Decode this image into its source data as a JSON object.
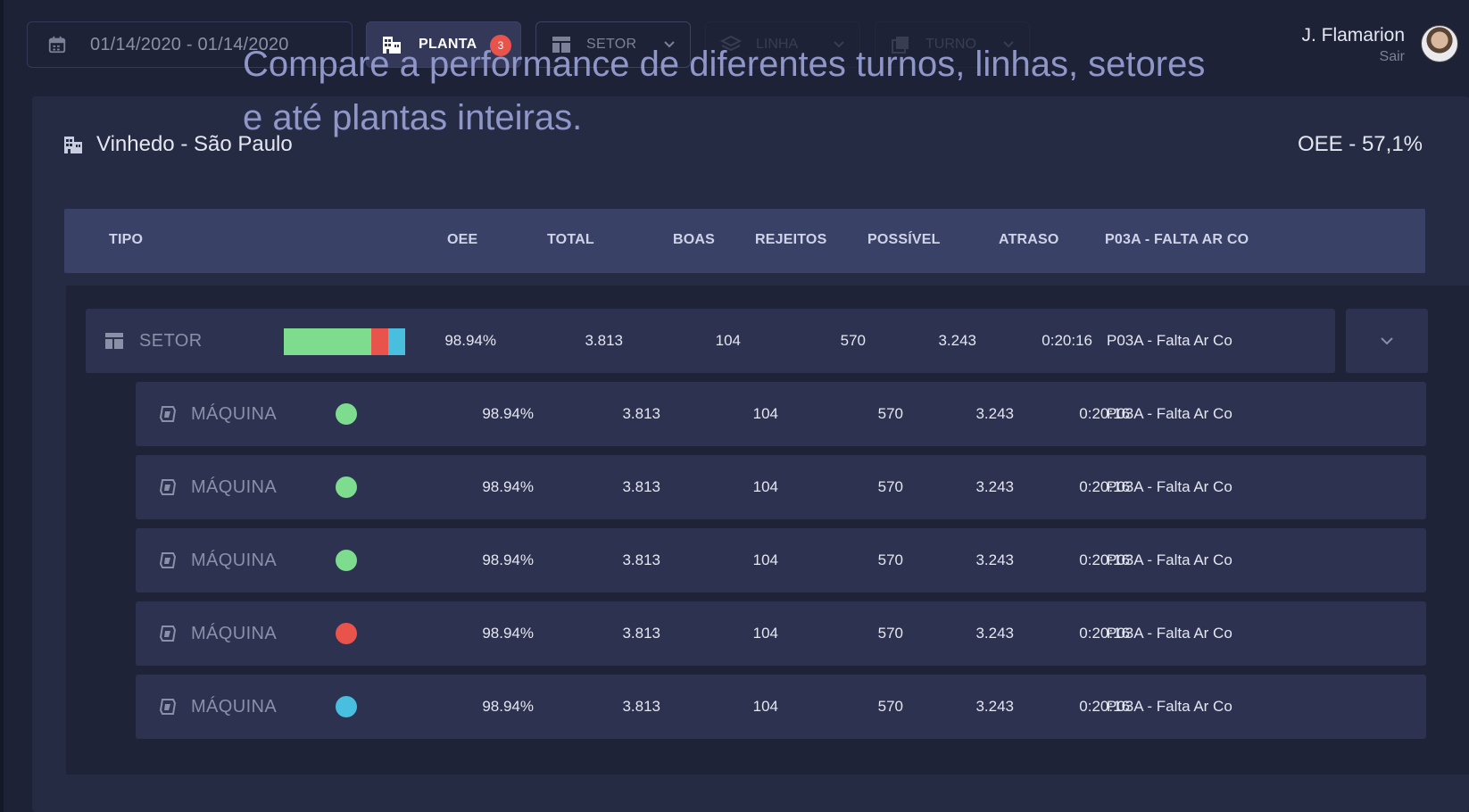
{
  "topbar": {
    "date_range": "01/14/2020 - 01/14/2020",
    "planta_label": "PLANTA",
    "planta_badge": "3",
    "setor_label": "SETOR",
    "linha_label": "LINHA",
    "turno_label": "TURNO",
    "user_name": "J. Flamarion",
    "user_exit": "Sair"
  },
  "caption": "Compare a performance de diferentes turnos, linhas, setores e até plantas inteiras.",
  "plant": {
    "name": "Vinhedo - São Paulo",
    "oee": "OEE - 57,1%"
  },
  "table": {
    "headers": {
      "tipo": "TIPO",
      "oee": "OEE",
      "total": "TOTAL",
      "boas": "BOAS",
      "rejeitos": "REJEITOS",
      "possivel": "POSSÍVEL",
      "atraso": "ATRASO",
      "motivo": "P03A - FALTA AR CO"
    },
    "setor_row": {
      "type": "SETOR",
      "bar_segments": [
        {
          "fraction": 0.72,
          "color": "#7ddc8e"
        },
        {
          "fraction": 0.14,
          "color": "#e8534c"
        },
        {
          "fraction": 0.14,
          "color": "#49bfe0"
        }
      ],
      "oee": "98.94%",
      "total": "3.813",
      "boas": "104",
      "rejeitos": "570",
      "possivel": "3.243",
      "atraso": "0:20:16",
      "motivo": "P03A - Falta Ar Co"
    },
    "machine_rows": [
      {
        "type": "MÁQUINA",
        "status_color": "#7ddc8e",
        "oee": "98.94%",
        "total": "3.813",
        "boas": "104",
        "rejeitos": "570",
        "possivel": "3.243",
        "atraso": "0:20:16",
        "motivo": "P03A - Falta Ar Co"
      },
      {
        "type": "MÁQUINA",
        "status_color": "#7ddc8e",
        "oee": "98.94%",
        "total": "3.813",
        "boas": "104",
        "rejeitos": "570",
        "possivel": "3.243",
        "atraso": "0:20:16",
        "motivo": "P03A - Falta Ar Co"
      },
      {
        "type": "MÁQUINA",
        "status_color": "#7ddc8e",
        "oee": "98.94%",
        "total": "3.813",
        "boas": "104",
        "rejeitos": "570",
        "possivel": "3.243",
        "atraso": "0:20:16",
        "motivo": "P03A - Falta Ar Co"
      },
      {
        "type": "MÁQUINA",
        "status_color": "#e8534c",
        "oee": "98.94%",
        "total": "3.813",
        "boas": "104",
        "rejeitos": "570",
        "possivel": "3.243",
        "atraso": "0:20:16",
        "motivo": "P03A - Falta Ar Co"
      },
      {
        "type": "MÁQUINA",
        "status_color": "#49bfe0",
        "oee": "98.94%",
        "total": "3.813",
        "boas": "104",
        "rejeitos": "570",
        "possivel": "3.243",
        "atraso": "0:20:16",
        "motivo": "P03A - Falta Ar Co"
      }
    ]
  }
}
